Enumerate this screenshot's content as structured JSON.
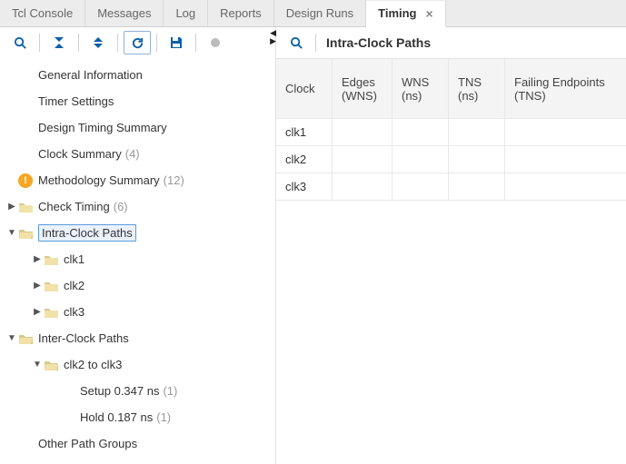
{
  "tabs": [
    {
      "label": "Tcl Console"
    },
    {
      "label": "Messages"
    },
    {
      "label": "Log"
    },
    {
      "label": "Reports"
    },
    {
      "label": "Design Runs"
    },
    {
      "label": "Timing",
      "active": true
    }
  ],
  "left_toolbar_icons": {
    "search": "search",
    "collapse": "collapse",
    "expand": "expand",
    "refresh": "refresh",
    "save": "save",
    "circle": "circle"
  },
  "tree": {
    "general_info": "General Information",
    "timer_settings": "Timer Settings",
    "design_timing_summary": "Design Timing Summary",
    "clock_summary": {
      "label": "Clock Summary",
      "count": "(4)"
    },
    "methodology_summary": {
      "label": "Methodology Summary",
      "count": "(12)"
    },
    "check_timing": {
      "label": "Check Timing",
      "count": "(6)"
    },
    "intra_clock_paths": {
      "label": "Intra-Clock Paths"
    },
    "intra_children": [
      "clk1",
      "clk2",
      "clk3"
    ],
    "inter_clock_paths": {
      "label": "Inter-Clock Paths"
    },
    "inter_child": "clk2 to clk3",
    "setup": {
      "label": "Setup 0.347 ns",
      "count": "(1)"
    },
    "hold": {
      "label": "Hold 0.187 ns",
      "count": "(1)"
    },
    "other_path_groups": "Other Path Groups"
  },
  "right": {
    "title": "Intra-Clock Paths",
    "columns": {
      "clock": "Clock",
      "edges": "Edges (WNS)",
      "wns": "WNS (ns)",
      "tns": "TNS (ns)",
      "fail": "Failing Endpoints (TNS)"
    },
    "rows": [
      {
        "clock": "clk1"
      },
      {
        "clock": "clk2"
      },
      {
        "clock": "clk3"
      }
    ]
  }
}
